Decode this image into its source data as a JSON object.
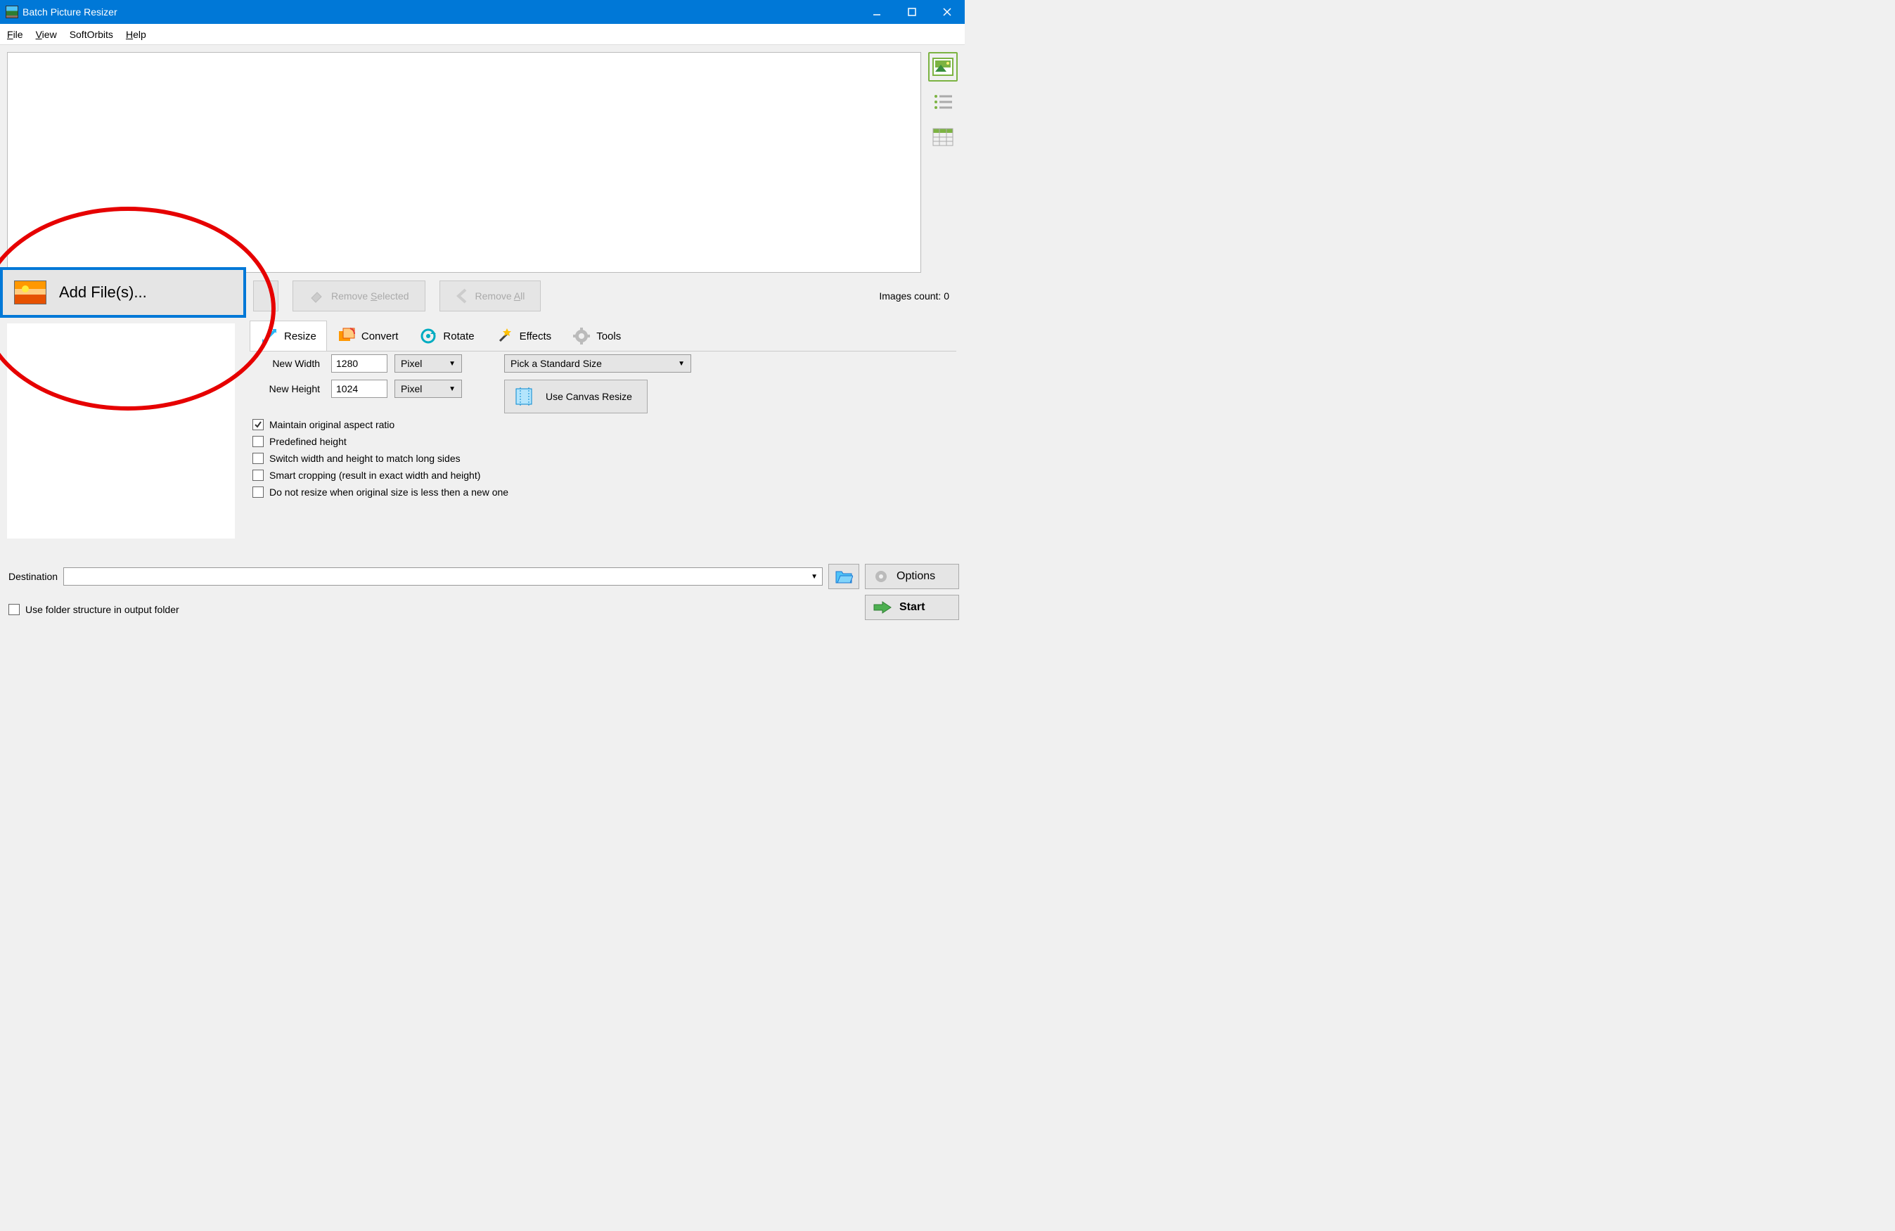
{
  "window": {
    "title": "Batch Picture Resizer"
  },
  "menu": {
    "file": "File",
    "view": "View",
    "softorbits": "SoftOrbits",
    "help": "Help"
  },
  "toolbar": {
    "add_files": "Add File(s)...",
    "remove_selected_pre": "Remove ",
    "remove_selected_u": "S",
    "remove_selected_post": "elected",
    "remove_all_pre": "Remove ",
    "remove_all_u": "A",
    "remove_all_post": "ll",
    "images_count": "Images count: 0"
  },
  "tabs": {
    "resize": "Resize",
    "convert": "Convert",
    "rotate": "Rotate",
    "effects": "Effects",
    "tools": "Tools"
  },
  "resize": {
    "width_label": "New Width",
    "width_value": "1280",
    "height_label": "New Height",
    "height_value": "1024",
    "unit_width": "Pixel",
    "unit_height": "Pixel",
    "std_size": "Pick a Standard Size",
    "canvas_btn": "Use Canvas Resize",
    "chk_aspect": "Maintain original aspect ratio",
    "chk_predef": "Predefined height",
    "chk_switch": "Switch width and height to match long sides",
    "chk_smart": "Smart cropping (result in exact width and height)",
    "chk_noresize": "Do not resize when original size is less then a new one"
  },
  "bottom": {
    "destination_label": "Destination",
    "options": "Options",
    "start": "Start",
    "folder_structure": "Use folder structure in output folder"
  }
}
